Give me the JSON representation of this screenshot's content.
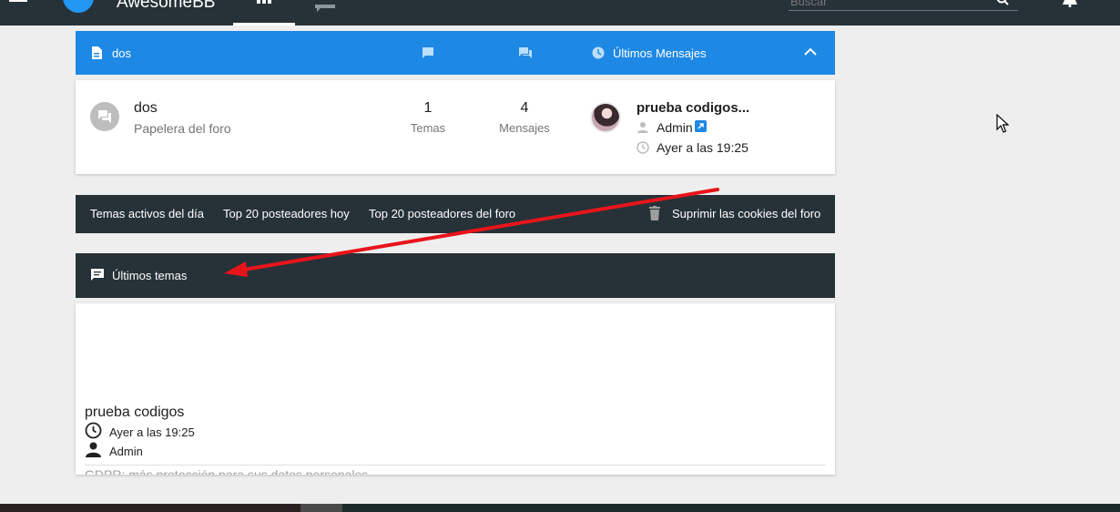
{
  "topbar": {
    "brand": "AwesomeBB",
    "search_placeholder": "Buscar",
    "bg_color": "#263238"
  },
  "category": {
    "title": "dos",
    "last_posts_label": "Últimos Mensajes",
    "color": "#1e88e5"
  },
  "forum": {
    "name": "dos",
    "description": "Papelera del foro",
    "topics_count": "1",
    "topics_label": "Temas",
    "posts_count": "4",
    "posts_label": "Mensajes",
    "last_post": {
      "title": "prueba codigos...",
      "author": "Admin",
      "time": "Ayer a las 19:25"
    }
  },
  "links": {
    "active_topics": "Temas activos del día",
    "top20_today": "Top 20 posteadores hoy",
    "top20_forum": "Top 20 posteadores del foro",
    "delete_cookies": "Suprimir las cookies del foro"
  },
  "latest": {
    "header": "Últimos temas",
    "topic": {
      "title": "prueba codigos",
      "time": "Ayer a las 19:25",
      "author": "Admin"
    },
    "next_topic": "GDPR: más protección para sus datos personales"
  },
  "annotation": {
    "arrow_color": "#e8141b"
  }
}
